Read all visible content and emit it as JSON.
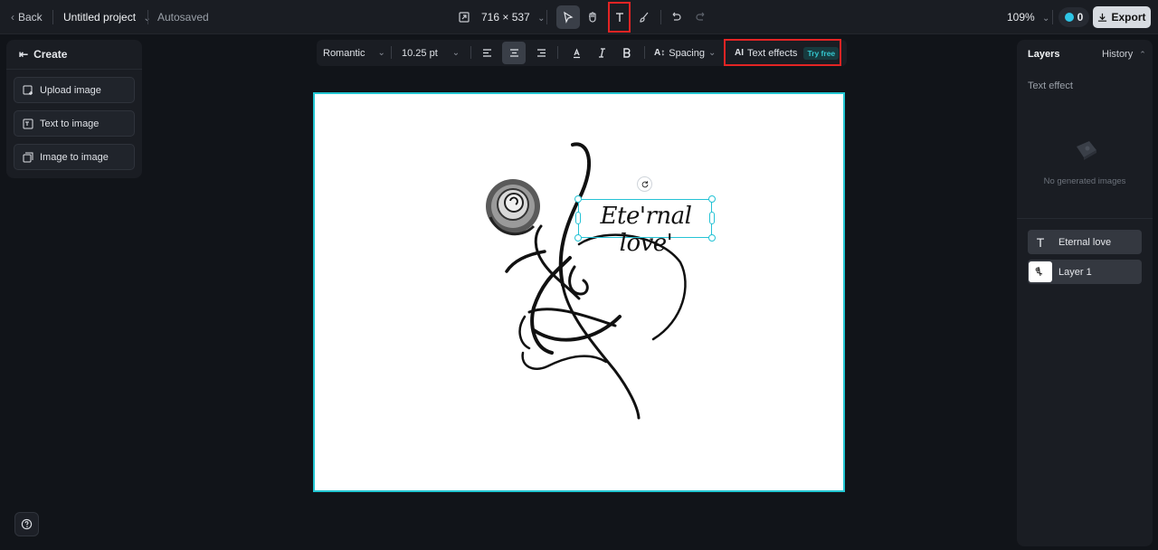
{
  "topbar": {
    "back_label": "Back",
    "project_title": "Untitled project",
    "save_status": "Autosaved",
    "canvas_size": "716 × 537",
    "zoom": "109%",
    "credits": "0",
    "export_label": "Export",
    "icons": [
      "resize-icon",
      "select-pointer-icon",
      "hand-pan-icon",
      "text-tool-icon",
      "brush-icon",
      "undo-icon",
      "redo-icon",
      "credit-icon",
      "download-icon"
    ]
  },
  "left_panel": {
    "header": "Create",
    "buttons": [
      {
        "label": "Upload image",
        "icon": "upload-image-icon"
      },
      {
        "label": "Text to image",
        "icon": "text-to-image-icon"
      },
      {
        "label": "Image to image",
        "icon": "image-to-image-icon"
      }
    ]
  },
  "text_toolbar": {
    "font_family": "Romantic",
    "font_size": "10.25 pt",
    "spacing_label": "Spacing",
    "effects_label": "Text effects",
    "effects_ai_badge": "AI",
    "try_free": "Try free"
  },
  "canvas": {
    "text_layer_content": "Ete'rnal love'",
    "background": "#ffffff",
    "selection_color": "#22c6d2"
  },
  "right_panel": {
    "layers_tab": "Layers",
    "history_tab": "History",
    "section_title": "Text effect",
    "empty_state": "No generated images",
    "layers": [
      {
        "name": "Eternal love",
        "kind": "text"
      },
      {
        "name": "Layer 1",
        "kind": "image"
      }
    ]
  },
  "colors": {
    "accent": "#2ec5e6",
    "highlight_box": "#e32424",
    "panel_bg": "#1a1d23",
    "app_bg": "#111419"
  }
}
